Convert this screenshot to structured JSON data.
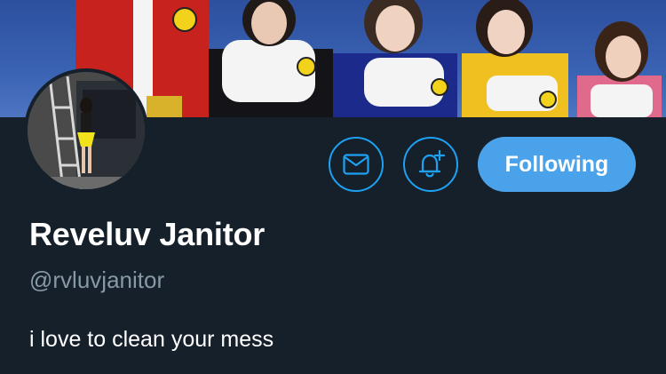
{
  "profile": {
    "display_name": "Reveluv Janitor",
    "handle": "@rvluvjanitor",
    "bio": "i love to clean your mess"
  },
  "actions": {
    "message_icon": "envelope-icon",
    "notification_icon": "bell-plus-icon",
    "follow_label": "Following"
  },
  "colors": {
    "background": "#15202b",
    "accent": "#1da1f2",
    "following_button": "#4aa3ea",
    "secondary_text": "#8899a6"
  }
}
